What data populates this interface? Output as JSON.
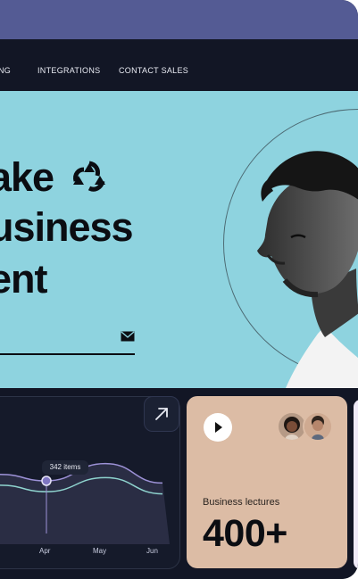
{
  "nav": {
    "items": [
      "NG",
      "INTEGRATIONS",
      "CONTACT SALES"
    ]
  },
  "hero": {
    "lines": [
      "ake",
      "usiness",
      "ent"
    ]
  },
  "chart_data": {
    "type": "line",
    "categories": [
      "Apr",
      "May",
      "Jun"
    ],
    "tooltip": "342 items",
    "series": [
      {
        "values": [
          48,
          42,
          58,
          40
        ]
      },
      {
        "values": [
          38,
          32,
          45,
          30
        ]
      }
    ]
  },
  "promo": {
    "label": "Business lectures",
    "value": "400+"
  },
  "colors": {
    "top_bar": "#545b94",
    "nav_bg": "#121625",
    "hero_bg": "#8ed3df",
    "promo_bg": "#dcbca5"
  },
  "icons": {
    "logo": "triquetra-logo-icon",
    "mail": "mail-icon",
    "arrow": "arrow-up-right-icon",
    "play": "play-icon"
  }
}
